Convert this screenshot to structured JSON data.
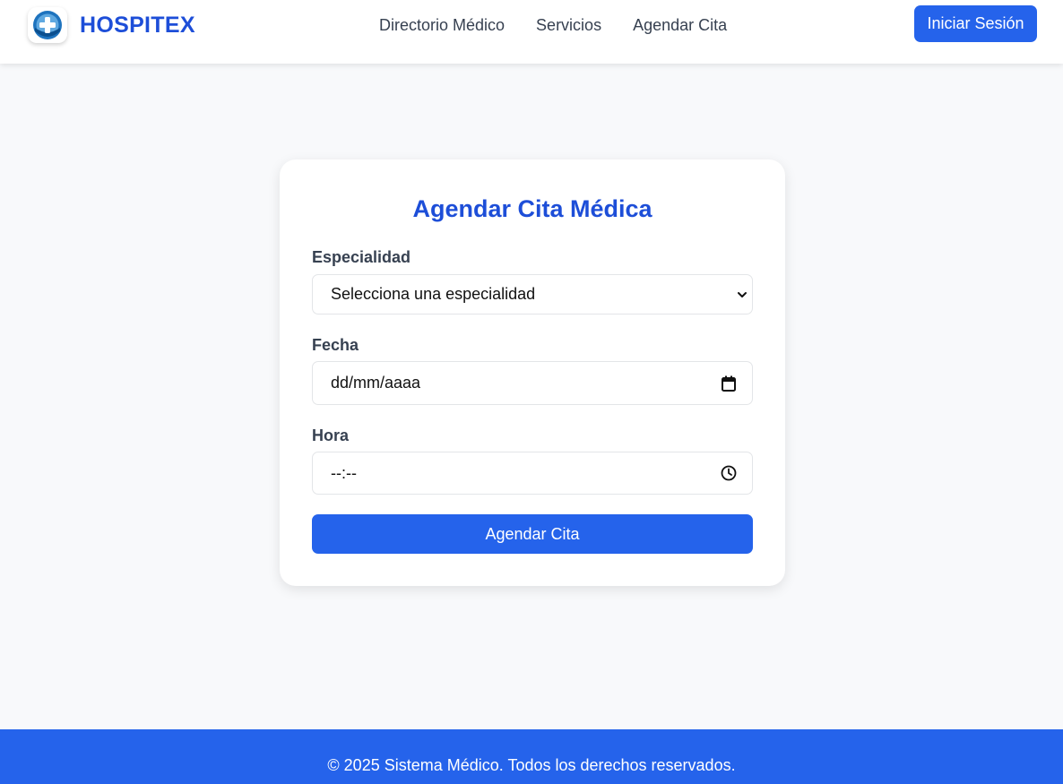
{
  "header": {
    "brand": "HOSPITEX",
    "nav": [
      "Directorio Médico",
      "Servicios",
      "Agendar Cita"
    ],
    "login_label": "Iniciar Sesión"
  },
  "form": {
    "title": "Agendar Cita Médica",
    "specialty": {
      "label": "Especialidad",
      "selected": "Selecciona una especialidad"
    },
    "date": {
      "label": "Fecha",
      "placeholder": "dd/mm/aaaa"
    },
    "time": {
      "label": "Hora",
      "placeholder": "--:--"
    },
    "submit_label": "Agendar Cita"
  },
  "footer": {
    "text": "© 2025 Sistema Médico. Todos los derechos reservados."
  },
  "colors": {
    "primary": "#2563eb",
    "title": "#1d4ed8",
    "background": "#f8f9fb"
  },
  "icons": {
    "logo": "medical-cross-logo-icon",
    "select": "chevron-down-icon",
    "date": "calendar-icon",
    "time": "clock-icon"
  }
}
